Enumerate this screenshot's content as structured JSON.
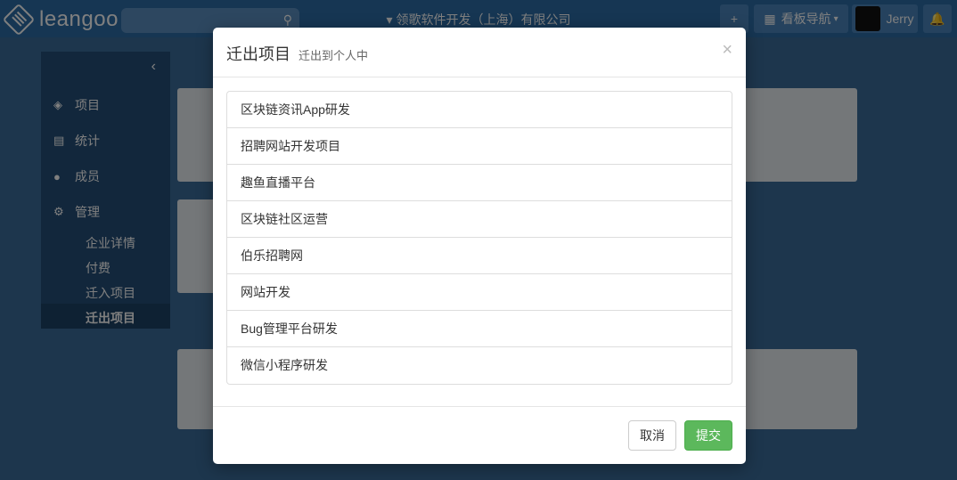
{
  "topbar": {
    "logo_text": "leangoo",
    "company": "▾ 领歌软件开发（上海）有限公司",
    "add_icon": "plus-icon",
    "board_nav_label": "看板导航",
    "user_name": "Jerry",
    "bell_icon": "bell-icon"
  },
  "sidebar": {
    "items": [
      {
        "label": "项目",
        "icon": "cubes-icon"
      },
      {
        "label": "统计",
        "icon": "bar-chart-icon"
      },
      {
        "label": "成员",
        "icon": "users-icon"
      },
      {
        "label": "管理",
        "icon": "gear-icon"
      }
    ],
    "sub_items": [
      "企业详情",
      "付费",
      "迁入项目",
      "迁出项目"
    ]
  },
  "modal": {
    "title": "迁出项目",
    "subtitle": "迁出到个人中",
    "close_label": "×",
    "projects": [
      "区块链资讯App研发",
      "招聘网站开发项目",
      "趣鱼直播平台",
      "区块链社区运营",
      "伯乐招聘网",
      "网站开发",
      "Bug管理平台研发",
      "微信小程序研发"
    ],
    "cancel_label": "取消",
    "submit_label": "提交"
  }
}
